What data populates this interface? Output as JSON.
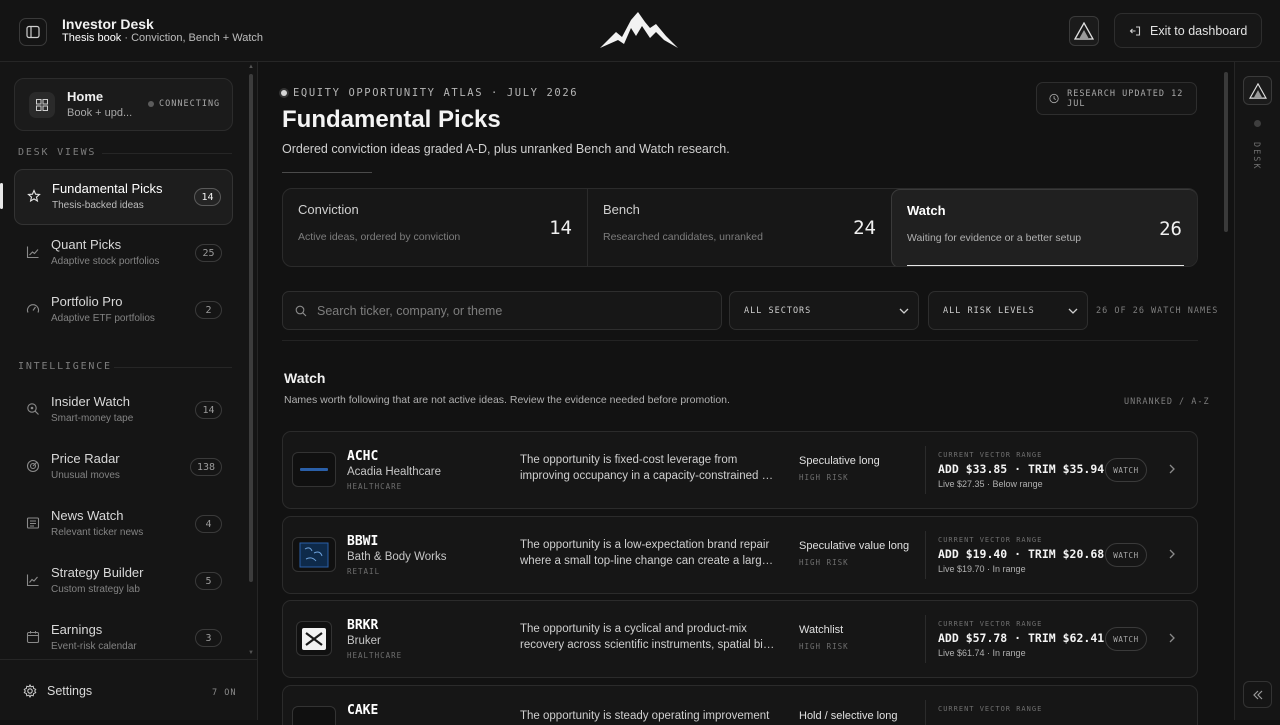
{
  "topbar": {
    "title": "Investor Desk",
    "subtitle_book": "Thesis book",
    "subtitle_rest": " · Conviction, Bench + Watch",
    "exit_label": "Exit to dashboard"
  },
  "sidebar": {
    "home": {
      "title": "Home",
      "subtitle": "Book + upd...",
      "status": "CONNECTING"
    },
    "desk_views_label": "DESK VIEWS",
    "intelligence_label": "INTELLIGENCE",
    "desk_views": [
      {
        "title": "Fundamental Picks",
        "subtitle": "Thesis-backed ideas",
        "badge": "14",
        "icon": "star-icon",
        "active": true
      },
      {
        "title": "Quant Picks",
        "subtitle": "Adaptive stock portfolios",
        "badge": "25",
        "icon": "trend-chart-icon"
      },
      {
        "title": "Portfolio Pro",
        "subtitle": "Adaptive ETF portfolios",
        "badge": "2",
        "icon": "gauge-icon"
      }
    ],
    "intelligence": [
      {
        "title": "Insider Watch",
        "subtitle": "Smart-money tape",
        "badge": "14",
        "icon": "magnifier-icon"
      },
      {
        "title": "Price Radar",
        "subtitle": "Unusual moves",
        "badge": "138",
        "icon": "radar-icon"
      },
      {
        "title": "News Watch",
        "subtitle": "Relevant ticker news",
        "badge": "4",
        "icon": "newspaper-icon"
      },
      {
        "title": "Strategy Builder",
        "subtitle": "Custom strategy lab",
        "badge": "5",
        "icon": "line-chart-icon"
      },
      {
        "title": "Earnings",
        "subtitle": "Event-risk calendar",
        "badge": "3",
        "icon": "calendar-icon"
      }
    ],
    "settings_label": "Settings",
    "settings_status": "7 ON"
  },
  "main": {
    "eyebrow": "EQUITY OPPORTUNITY ATLAS · JULY 2026",
    "title": "Fundamental Picks",
    "description": "Ordered conviction ideas graded A-D, plus unranked Bench and Watch research.",
    "updated": "RESEARCH UPDATED 12 JUL",
    "tabs": [
      {
        "title": "Conviction",
        "subtitle": "Active ideas, ordered by conviction",
        "count": "14"
      },
      {
        "title": "Bench",
        "subtitle": "Researched candidates, unranked",
        "count": "24"
      },
      {
        "title": "Watch",
        "subtitle": "Waiting for evidence or a better setup",
        "count": "26",
        "active": true
      }
    ],
    "search_placeholder": "Search ticker, company, or theme",
    "sector_select": "ALL SECTORS",
    "risk_select": "ALL RISK LEVELS",
    "filter_count": "26 OF 26 WATCH NAMES",
    "list_title": "Watch",
    "list_description": "Names worth following that are not active ideas. Review the evidence needed before promotion.",
    "list_sort": "UNRANKED / A-Z",
    "range_label": "CURRENT VECTOR RANGE",
    "watch_label": "WATCH",
    "rows": [
      {
        "ticker": "ACHC",
        "company": "Acadia Healthcare",
        "sector": "HEALTHCARE",
        "thesis_l1": "The opportunity is fixed-cost leverage from",
        "thesis_l2": "improving occupancy in a capacity-constrained behavioral health network.",
        "stance": "Speculative long",
        "risk": "HIGH RISK",
        "range": "ADD $33.85 · TRIM $35.94",
        "live": "Live $27.35",
        "range_status": "Below range"
      },
      {
        "ticker": "BBWI",
        "company": "Bath & Body Works",
        "sector": "RETAIL",
        "thesis_l1": "The opportunity is a low-expectation brand repair",
        "thesis_l2": "where a small top-line change can create a large earnings move.",
        "stance": "Speculative value long",
        "risk": "HIGH RISK",
        "range": "ADD $19.40 · TRIM $20.68",
        "live": "Live $19.70",
        "range_status": "In range"
      },
      {
        "ticker": "BRKR",
        "company": "Bruker",
        "sector": "HEALTHCARE",
        "thesis_l1": "The opportunity is a cyclical and product-mix",
        "thesis_l2": "recovery across scientific instruments, spatial biology and semis tools.",
        "stance": "Watchlist",
        "risk": "HIGH RISK",
        "range": "ADD $57.78 · TRIM $62.41",
        "live": "Live $61.74",
        "range_status": "In range"
      },
      {
        "ticker": "CAKE",
        "company": "",
        "sector": "",
        "thesis_l1": "The opportunity is steady operating improvement",
        "thesis_l2": "",
        "stance": "Hold / selective long",
        "risk": "",
        "range": "",
        "live": "",
        "range_status": ""
      }
    ]
  },
  "rail": {
    "label": "DESK"
  },
  "colors": {
    "background": "#121212",
    "panel": "#171717",
    "border": "#2b2b2b",
    "text": "#e8e8e8",
    "muted": "#7d7d7d"
  }
}
